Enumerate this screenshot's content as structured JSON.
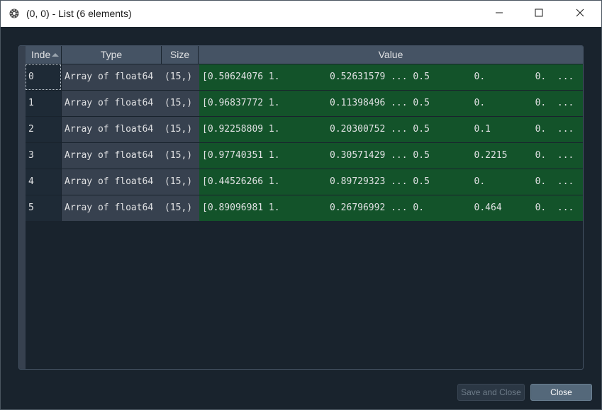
{
  "window": {
    "title": "(0, 0) - List (6 elements)"
  },
  "table": {
    "headers": {
      "index": "Inde",
      "type": "Type",
      "size": "Size",
      "value": "Value"
    },
    "rows": [
      {
        "index": "0",
        "type": "Array of float64",
        "size": "(15,)",
        "value": "[0.50624076 1.         0.52631579 ... 0.5        0.         0.  ..."
      },
      {
        "index": "1",
        "type": "Array of float64",
        "size": "(15,)",
        "value": "[0.96837772 1.         0.11398496 ... 0.5        0.         0.  ..."
      },
      {
        "index": "2",
        "type": "Array of float64",
        "size": "(15,)",
        "value": "[0.92258809 1.         0.20300752 ... 0.5        0.1        0.  ..."
      },
      {
        "index": "3",
        "type": "Array of float64",
        "size": "(15,)",
        "value": "[0.97740351 1.         0.30571429 ... 0.5        0.2215     0.  ..."
      },
      {
        "index": "4",
        "type": "Array of float64",
        "size": "(15,)",
        "value": "[0.44526266 1.         0.89729323 ... 0.5        0.         0.  ..."
      },
      {
        "index": "5",
        "type": "Array of float64",
        "size": "(15,)",
        "value": "[0.89096981 1.         0.26796992 ... 0.         0.464      0.  ..."
      }
    ]
  },
  "buttons": {
    "save_label": "Save and Close",
    "close_label": "Close"
  },
  "colors": {
    "background": "#19232d",
    "header": "#455364",
    "value_cell": "#13532a",
    "type_cell": "#37414f"
  },
  "icons": {
    "app": "spyder-icon",
    "minimize": "minimize-icon",
    "maximize": "maximize-icon",
    "close": "close-icon",
    "sort": "sort-ascending-icon"
  }
}
